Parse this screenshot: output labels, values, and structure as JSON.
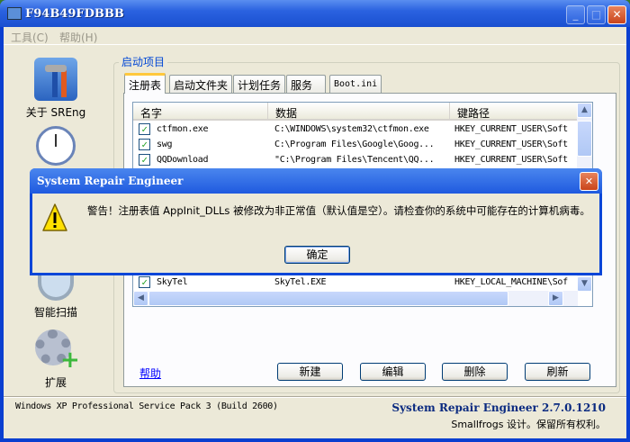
{
  "window": {
    "title": "F94B49FDBBB"
  },
  "menu": [
    "工具(C)",
    "帮助(H)"
  ],
  "sidebar": [
    {
      "label": "关于 SREng",
      "icon": "tools-icon"
    },
    {
      "label": "",
      "icon": "clock-icon"
    },
    {
      "label": "智能扫描",
      "icon": "magnifier-icon"
    },
    {
      "label": "扩展",
      "icon": "gear-plus-icon"
    }
  ],
  "group": {
    "label": "启动项目"
  },
  "tabs": [
    "注册表",
    "启动文件夹",
    "计划任务",
    "服务",
    "Boot.ini"
  ],
  "list": {
    "columns": [
      "名字",
      "数据",
      "键路径"
    ],
    "rows": [
      {
        "name": "ctfmon.exe",
        "data": "C:\\WINDOWS\\system32\\ctfmon.exe",
        "path": "HKEY_CURRENT_USER\\Soft"
      },
      {
        "name": "swg",
        "data": "C:\\Program Files\\Google\\Goog...",
        "path": "HKEY_CURRENT_USER\\Soft"
      },
      {
        "name": "QQDownload",
        "data": "\"C:\\Program Files\\Tencent\\QQ...",
        "path": "HKEY_CURRENT_USER\\Soft"
      },
      {
        "name": "SkyTel",
        "data": "SkyTel.EXE",
        "path": "HKEY_LOCAL_MACHINE\\Sof"
      }
    ]
  },
  "buttons": {
    "help": "帮助",
    "new": "新建",
    "edit": "编辑",
    "delete": "删除",
    "refresh": "刷新"
  },
  "status": {
    "os": "Windows XP Professional Service Pack 3 (Build 2600)",
    "version": "System Repair Engineer 2.7.0.1210",
    "copyright": "Smallfrogs 设计。保留所有权利。"
  },
  "dialog": {
    "title": "System Repair Engineer",
    "message": "警告！注册表值 AppInit_DLLs 被修改为非正常值（默认值是空）。请检查你的系统中可能存在的计算机病毒。",
    "ok": "确定"
  }
}
